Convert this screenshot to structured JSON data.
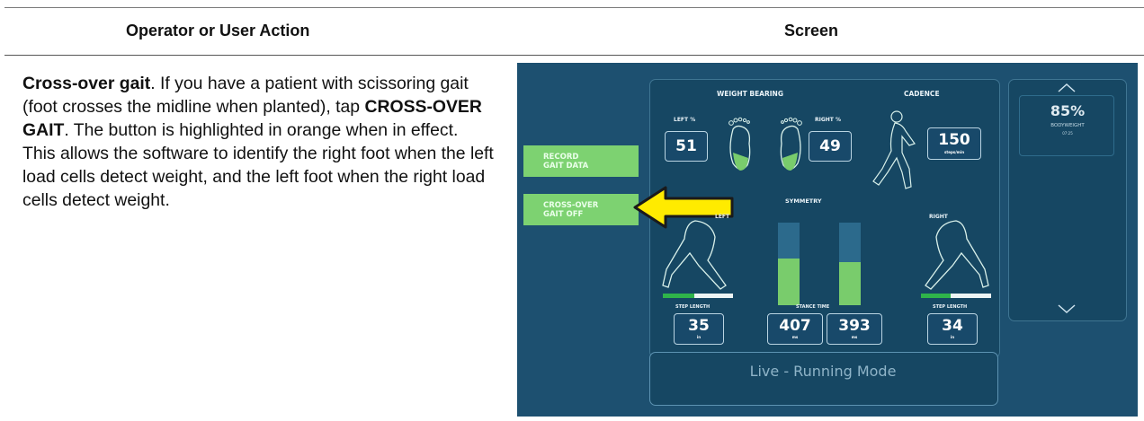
{
  "table": {
    "col_action_header": "Operator or User Action",
    "col_screen_header": "Screen",
    "paragraph": {
      "bold_lead": "Cross-over gait",
      "text_a": ". If you have a patient with scissoring gait (foot crosses the midline when planted), tap ",
      "bold_button": "CROSS-OVER GAIT",
      "text_b": ". The button is highlighted in orange when in effect. This allows the software to identify the right foot when the left load cells detect weight, and the left foot when the right load cells detect weight."
    }
  },
  "screen": {
    "weight_bearing_label": "WEIGHT BEARING",
    "cadence_label": "CADENCE",
    "left_pct_label": "LEFT %",
    "right_pct_label": "RIGHT %",
    "left_value": "51",
    "right_value": "49",
    "cadence_value": "150",
    "cadence_unit": "steps/min",
    "bodyweight_value": "85%",
    "bodyweight_label": "BODYWEIGHT",
    "bodyweight_sub": "07:25",
    "record_button": [
      "RECORD",
      "GAIT DATA"
    ],
    "crossover_button": [
      "CROSS-OVER",
      "GAIT OFF"
    ],
    "symmetry_label": "SYMMETRY",
    "left_leg_label": "LEFT",
    "right_leg_label": "RIGHT",
    "step_length_label": "STEP LENGTH",
    "stance_time_label": "STANCE TIME",
    "left_step_length": "35",
    "left_step_unit": "in",
    "stance_left": "407",
    "stance_right": "393",
    "stance_unit": "ms",
    "right_step_length": "34",
    "right_step_unit": "in",
    "status": "Live - Running Mode",
    "symmetry_fill": {
      "left": 0.56,
      "right": 0.52
    },
    "step_length_fill": {
      "left": 0.45,
      "right": 0.42
    },
    "colors": {
      "accent_green": "#7dd271",
      "arrow_yellow": "#ffeb00",
      "screen_bg": "#1d5070"
    }
  }
}
